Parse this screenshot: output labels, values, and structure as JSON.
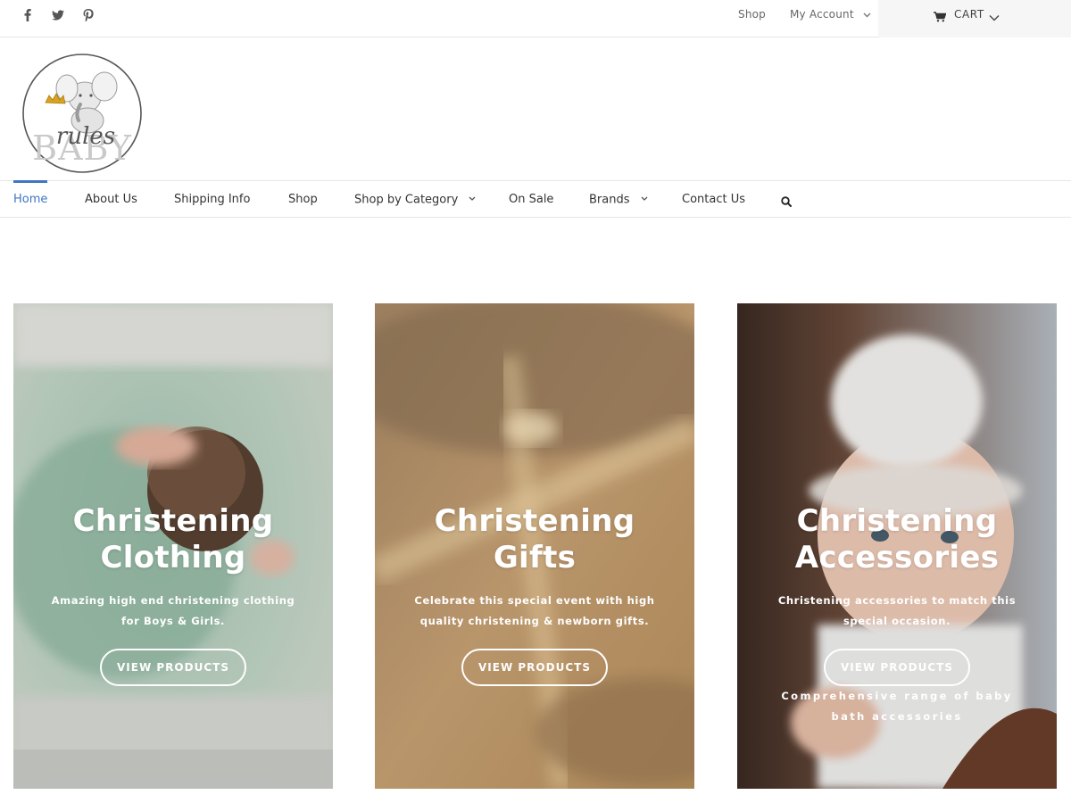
{
  "social": {
    "icons": [
      "facebook-icon",
      "twitter-icon",
      "pinterest-icon"
    ]
  },
  "topbar": {
    "shop_label": "Shop",
    "account_label": "My Account",
    "cart_label": "CART"
  },
  "logo": {
    "text_script": "rules",
    "text_main": "BABY"
  },
  "nav": {
    "items": [
      {
        "label": "Home",
        "active": true
      },
      {
        "label": "About Us"
      },
      {
        "label": "Shipping Info"
      },
      {
        "label": "Shop"
      },
      {
        "label": "Shop by Category",
        "dropdown": true
      },
      {
        "label": "On Sale"
      },
      {
        "label": "Brands",
        "dropdown": true
      },
      {
        "label": "Contact Us"
      }
    ],
    "accent_color": "#3f76c2"
  },
  "cards": [
    {
      "title_line1": "Christening",
      "title_line2": "Clothing",
      "description_line1": "Amazing high end christening clothing",
      "description_line2": "for Boys & Girls.",
      "button_label": "VIEW PRODUCTS"
    },
    {
      "title_line1": "Christening",
      "title_line2": "Gifts",
      "description_line1": "Celebrate this special event with high",
      "description_line2": "quality christening & newborn gifts.",
      "button_label": "VIEW PRODUCTS"
    },
    {
      "title_line1": "Christening",
      "title_line2": "Accessories",
      "description_line1": "Christening accessories to match this",
      "description_line2": "special occasion.",
      "button_label": "VIEW PRODUCTS",
      "extra_line1": "Comprehensive range of baby",
      "extra_line2": "bath accessories"
    }
  ]
}
